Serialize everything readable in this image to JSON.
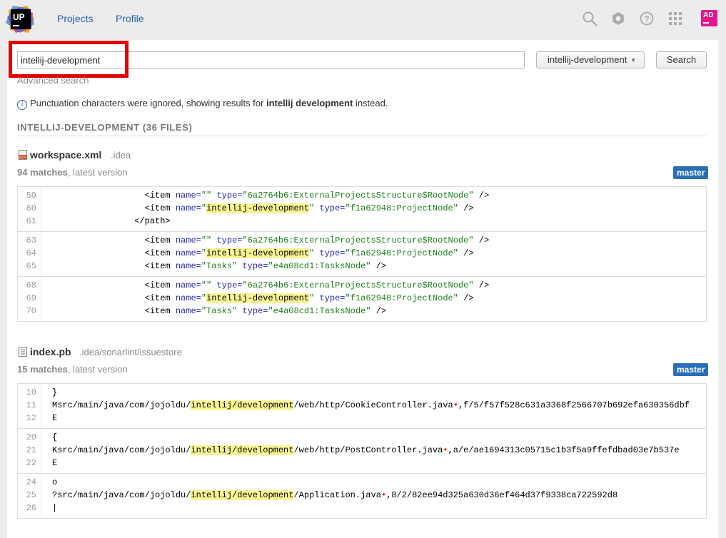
{
  "nav": {
    "projects": "Projects",
    "profile": "Profile",
    "logo_text": "UP"
  },
  "user": {
    "initials": "AD"
  },
  "search": {
    "query": "intellij-development",
    "advanced": "Advanced search",
    "project": "intellij-development",
    "button": "Search"
  },
  "notice": {
    "prefix": "Punctuation characters were ignored, showing results for ",
    "term": "intellij development",
    "suffix": " instead."
  },
  "section": {
    "title": "INTELLIJ-DEVELOPMENT (36 FILES)"
  },
  "files": [
    {
      "name": "workspace.xml",
      "path": ".idea",
      "matches_count": "94 matches",
      "matches_suffix": ", latest version",
      "branch": "master",
      "snippets": [
        [
          {
            "n": "59",
            "indent": "                  ",
            "segs": [
              [
                "t",
                "<item "
              ],
              [
                "a",
                "name="
              ],
              [
                "v",
                "\"\""
              ],
              [
                "t",
                " "
              ],
              [
                "a",
                "type="
              ],
              [
                "v",
                "\"6a2764b6:ExternalProjectsStructure$RootNode\""
              ],
              [
                "t",
                " />"
              ]
            ]
          },
          {
            "n": "60",
            "indent": "                  ",
            "segs": [
              [
                "t",
                "<item "
              ],
              [
                "a",
                "name="
              ],
              [
                "v",
                "\""
              ],
              [
                "h",
                "intellij-development"
              ],
              [
                "v",
                "\""
              ],
              [
                "t",
                " "
              ],
              [
                "a",
                "type="
              ],
              [
                "v",
                "\"f1a62948:ProjectNode\""
              ],
              [
                "t",
                " />"
              ]
            ]
          },
          {
            "n": "61",
            "indent": "                ",
            "segs": [
              [
                "t",
                "</path>"
              ]
            ]
          }
        ],
        [
          {
            "n": "63",
            "indent": "                  ",
            "segs": [
              [
                "t",
                "<item "
              ],
              [
                "a",
                "name="
              ],
              [
                "v",
                "\"\""
              ],
              [
                "t",
                " "
              ],
              [
                "a",
                "type="
              ],
              [
                "v",
                "\"6a2764b6:ExternalProjectsStructure$RootNode\""
              ],
              [
                "t",
                " />"
              ]
            ]
          },
          {
            "n": "64",
            "indent": "                  ",
            "segs": [
              [
                "t",
                "<item "
              ],
              [
                "a",
                "name="
              ],
              [
                "v",
                "\""
              ],
              [
                "h",
                "intellij-development"
              ],
              [
                "v",
                "\""
              ],
              [
                "t",
                " "
              ],
              [
                "a",
                "type="
              ],
              [
                "v",
                "\"f1a62948:ProjectNode\""
              ],
              [
                "t",
                " />"
              ]
            ]
          },
          {
            "n": "65",
            "indent": "                  ",
            "segs": [
              [
                "t",
                "<item "
              ],
              [
                "a",
                "name="
              ],
              [
                "v",
                "\"Tasks\""
              ],
              [
                "t",
                " "
              ],
              [
                "a",
                "type="
              ],
              [
                "v",
                "\"e4a08cd1:TasksNode\""
              ],
              [
                "t",
                " />"
              ]
            ]
          }
        ],
        [
          {
            "n": "68",
            "indent": "                  ",
            "segs": [
              [
                "t",
                "<item "
              ],
              [
                "a",
                "name="
              ],
              [
                "v",
                "\"\""
              ],
              [
                "t",
                " "
              ],
              [
                "a",
                "type="
              ],
              [
                "v",
                "\"6a2764b6:ExternalProjectsStructure$RootNode\""
              ],
              [
                "t",
                " />"
              ]
            ]
          },
          {
            "n": "69",
            "indent": "                  ",
            "segs": [
              [
                "t",
                "<item "
              ],
              [
                "a",
                "name="
              ],
              [
                "v",
                "\""
              ],
              [
                "h",
                "intellij-development"
              ],
              [
                "v",
                "\""
              ],
              [
                "t",
                " "
              ],
              [
                "a",
                "type="
              ],
              [
                "v",
                "\"f1a62948:ProjectNode\""
              ],
              [
                "t",
                " />"
              ]
            ]
          },
          {
            "n": "70",
            "indent": "                  ",
            "segs": [
              [
                "t",
                "<item "
              ],
              [
                "a",
                "name="
              ],
              [
                "v",
                "\"Tasks\""
              ],
              [
                "t",
                " "
              ],
              [
                "a",
                "type="
              ],
              [
                "v",
                "\"e4a08cd1:TasksNode\""
              ],
              [
                "t",
                " />"
              ]
            ]
          }
        ]
      ]
    },
    {
      "name": "index.pb",
      "path": ".idea/sonarlint/issuestore",
      "matches_count": "15 matches",
      "matches_suffix": ", latest version",
      "branch": "master",
      "snippets": [
        [
          {
            "n": "10",
            "indent": "",
            "segs": [
              [
                "t",
                "}"
              ]
            ]
          },
          {
            "n": "11",
            "indent": "",
            "segs": [
              [
                "t",
                "Msrc/main/java/com/jojoldu/"
              ],
              [
                "h",
                "intellij/development"
              ],
              [
                "t",
                "/web/http/CookieController.java"
              ],
              [
                "r",
                "•"
              ],
              [
                "t",
                ",f/5/f57f528c631a3368f2566707b692efa630356dbf"
              ]
            ]
          },
          {
            "n": "12",
            "indent": "",
            "segs": [
              [
                "t",
                "E"
              ]
            ]
          }
        ],
        [
          {
            "n": "20",
            "indent": "",
            "segs": [
              [
                "t",
                "{"
              ]
            ]
          },
          {
            "n": "21",
            "indent": "",
            "segs": [
              [
                "t",
                "Ksrc/main/java/com/jojoldu/"
              ],
              [
                "h",
                "intellij/development"
              ],
              [
                "t",
                "/web/http/PostController.java"
              ],
              [
                "r",
                "•"
              ],
              [
                "t",
                ",a/e/ae1694313c05715c1b3f5a9ffefdbad03e7b537e"
              ]
            ]
          },
          {
            "n": "22",
            "indent": "",
            "segs": [
              [
                "t",
                "E"
              ]
            ]
          }
        ],
        [
          {
            "n": "24",
            "indent": "",
            "segs": [
              [
                "t",
                "o"
              ]
            ]
          },
          {
            "n": "25",
            "indent": "",
            "segs": [
              [
                "t",
                "?src/main/java/com/jojoldu/"
              ],
              [
                "h",
                "intellij/development"
              ],
              [
                "t",
                "/Application.java"
              ],
              [
                "r",
                "•"
              ],
              [
                "t",
                ",8/2/82ee94d325a630d36ef464d37f9338ca722592d8"
              ]
            ]
          },
          {
            "n": "26",
            "indent": "",
            "segs": [
              [
                "t",
                "|"
              ]
            ]
          }
        ]
      ]
    }
  ]
}
